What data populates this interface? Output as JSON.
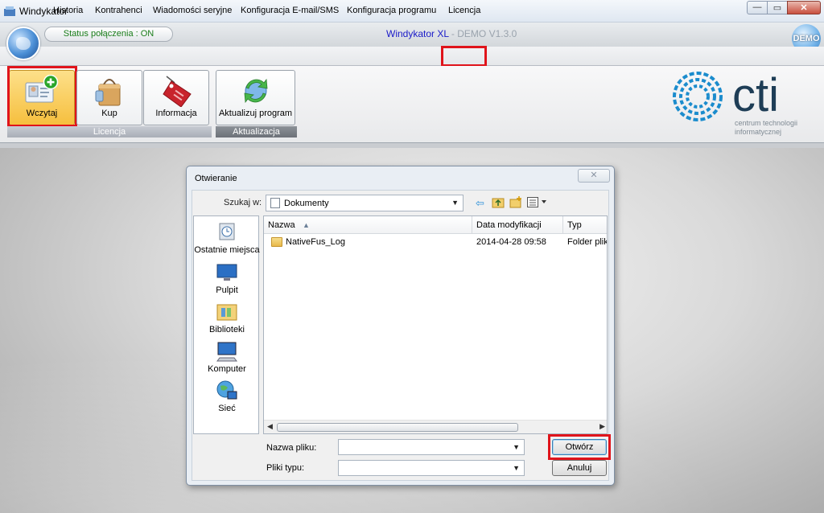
{
  "window": {
    "title": "Windykator",
    "controls": {
      "minimize": "—",
      "maximize": "▭",
      "close": "✕"
    }
  },
  "header": {
    "status": "Status połączenia : ON",
    "app_name": "Windykator XL",
    "version": " - DEMO V1.3.0",
    "demo_badge": "DEMO",
    "status_color": "#1a7d1a"
  },
  "menu": {
    "items": [
      "Historia",
      "Kontrahenci",
      "Wiadomości seryjne",
      "Konfiguracja E-mail/SMS",
      "Konfiguracja programu",
      "Licencja"
    ],
    "active": "Licencja"
  },
  "ribbon": {
    "buttons": [
      {
        "label": "Wczytaj",
        "icon": "license-card-add-icon"
      },
      {
        "label": "Kup",
        "icon": "shopping-bag-icon"
      },
      {
        "label": "Informacja",
        "icon": "price-tag-icon"
      },
      {
        "label": "Aktualizuj program",
        "icon": "refresh-globe-icon"
      }
    ],
    "groups": [
      "Licencja",
      "Aktualizacja"
    ]
  },
  "logo": {
    "text": "cti",
    "subtitle_line1": "centrum technologii",
    "subtitle_line2": "informatycznej",
    "color": "#1b8ccd"
  },
  "dialog": {
    "title": "Otwieranie",
    "close": "✕",
    "look_in_label": "Szukaj w:",
    "look_in_value": "Dokumenty",
    "places": [
      "Ostatnie miejsca",
      "Pulpit",
      "Biblioteki",
      "Komputer",
      "Sieć"
    ],
    "columns": [
      "Nazwa",
      "Data modyfikacji",
      "Typ"
    ],
    "files": [
      {
        "name": "NativeFus_Log",
        "date": "2014-04-28 09:58",
        "type": "Folder plik"
      }
    ],
    "filename_label": "Nazwa pliku:",
    "filetype_label": "Pliki typu:",
    "open_button": "Otwórz",
    "cancel_button": "Anuluj"
  },
  "highlight_color": "#e0141b"
}
